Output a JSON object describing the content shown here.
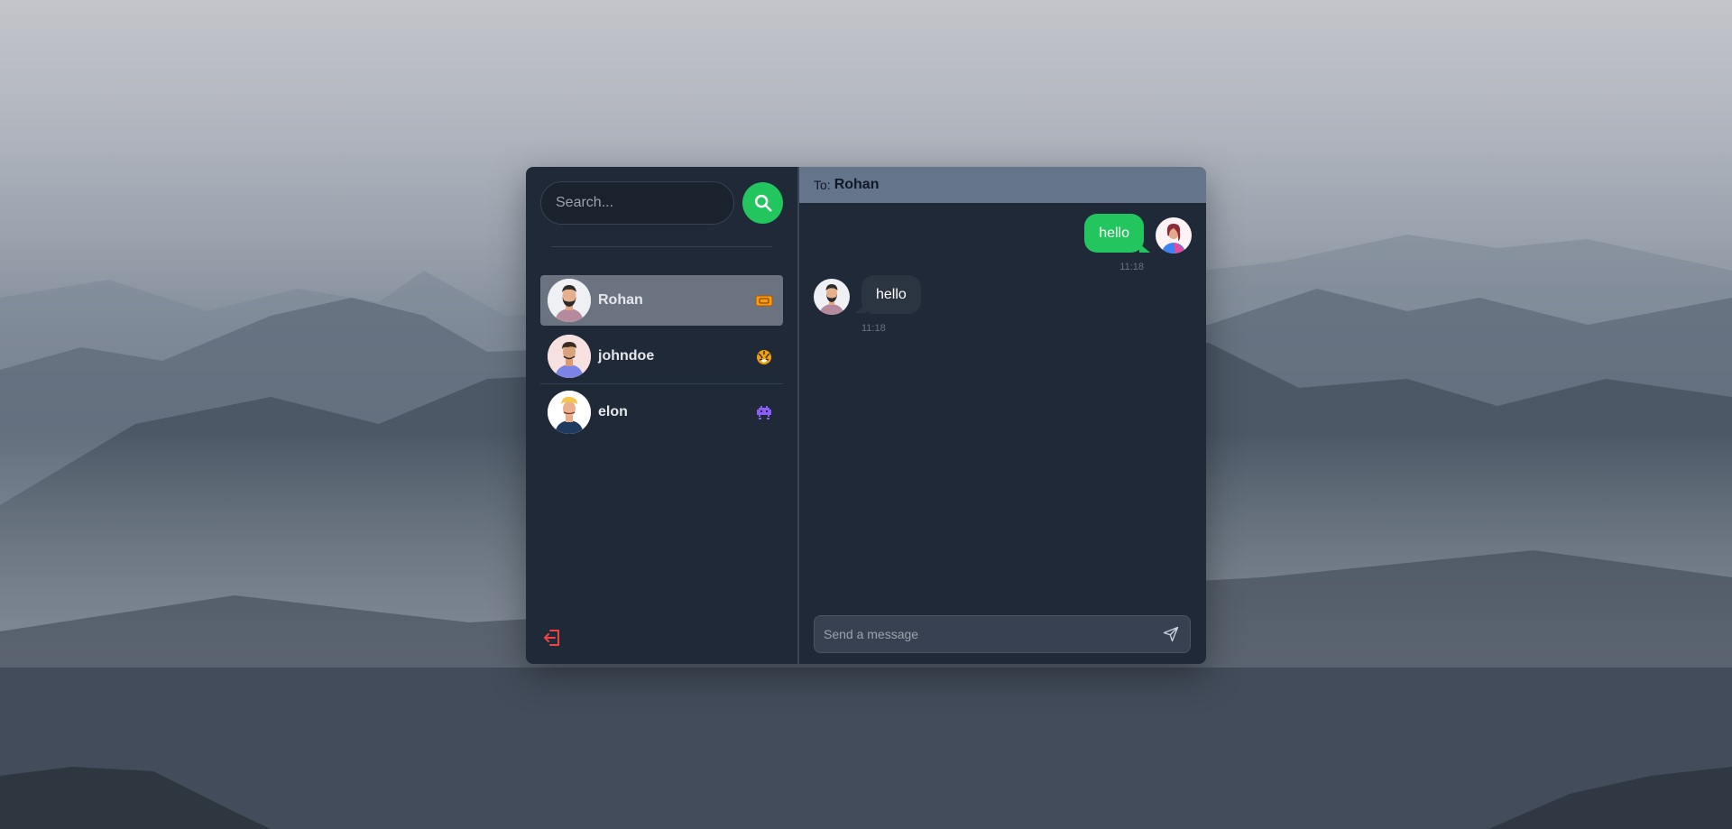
{
  "search": {
    "placeholder": "Search..."
  },
  "conversations": [
    {
      "name": "Rohan",
      "emoji": "ticket-icon",
      "selected": true
    },
    {
      "name": "johndoe",
      "emoji": "tiger-icon",
      "selected": false
    },
    {
      "name": "elon",
      "emoji": "space-invader-icon",
      "selected": false
    }
  ],
  "header": {
    "to_label": "To:",
    "recipient": "Rohan"
  },
  "messages": [
    {
      "direction": "outgoing",
      "text": "hello",
      "time": "11:18"
    },
    {
      "direction": "incoming",
      "text": "hello",
      "time": "11:18"
    }
  ],
  "composer": {
    "placeholder": "Send a message"
  },
  "colors": {
    "accent": "#22c55e",
    "panel": "#1f2937",
    "header": "#64748b",
    "selected": "#6b7280",
    "logout": "#ef4444"
  }
}
